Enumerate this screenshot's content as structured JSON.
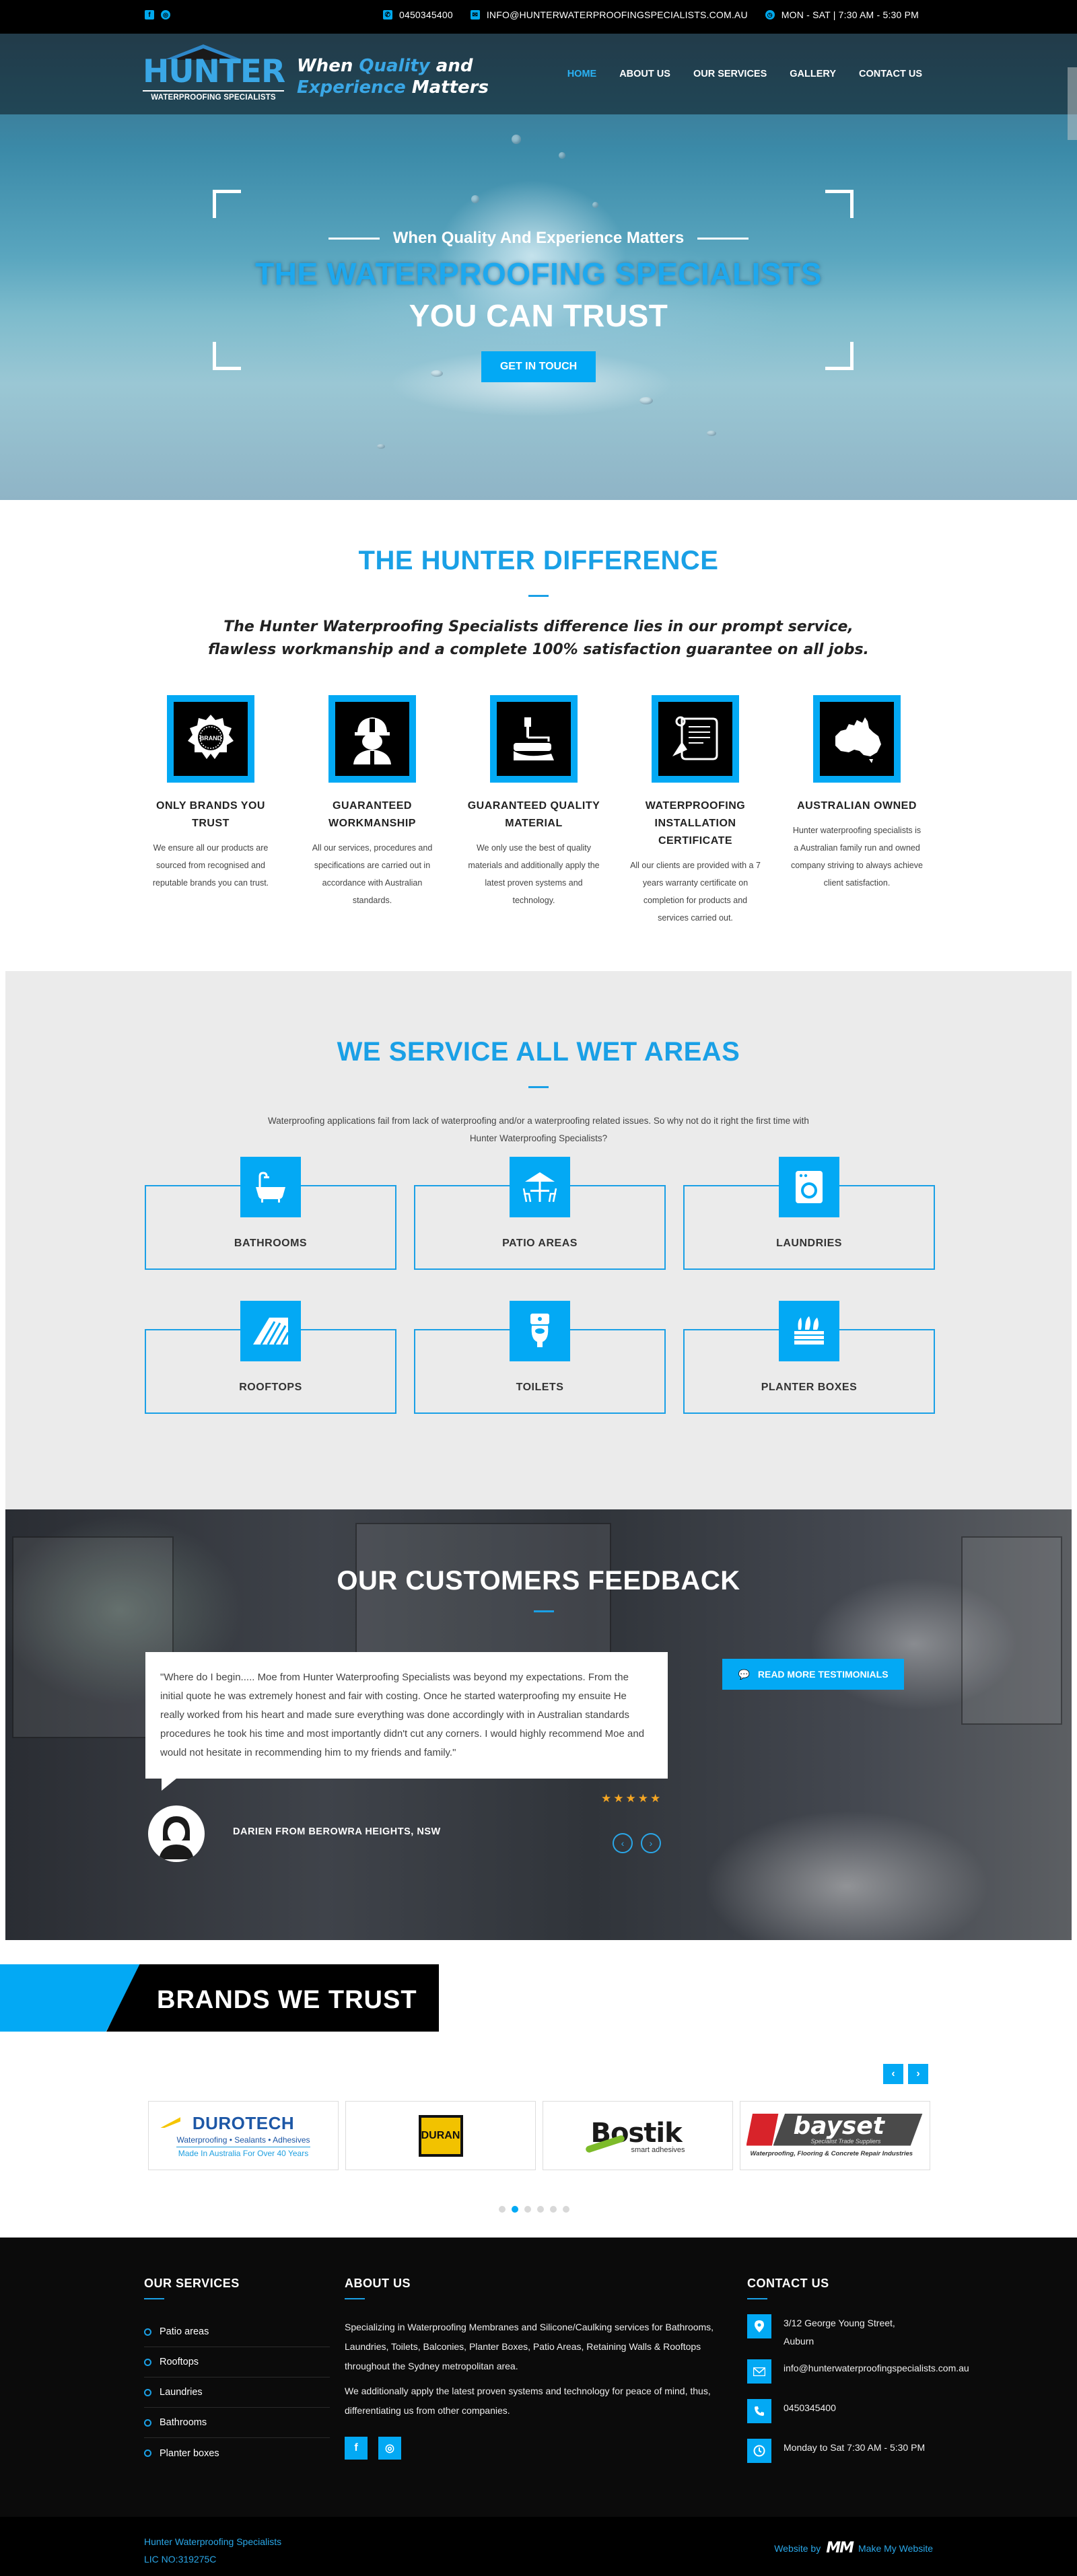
{
  "topbar": {
    "phone": "0450345400",
    "email": "INFO@HUNTERWATERPROOFINGSPECIALISTS.COM.AU",
    "hours": "MON - SAT | 7:30 AM - 5:30 PM"
  },
  "brand": {
    "logo_name": "HUNTER",
    "logo_sub": "WATERPROOFING SPECIALISTS",
    "tagline": [
      "When ",
      "Quality",
      " and",
      "Experience",
      " Matters"
    ]
  },
  "nav": [
    "HOME",
    "ABOUT US",
    "OUR SERVICES",
    "GALLERY",
    "CONTACT US"
  ],
  "hero": {
    "pre": "When Quality And Experience Matters",
    "line1": "THE WATERPROOFING SPECIALISTS",
    "line2": "YOU CAN TRUST",
    "cta": "GET IN TOUCH"
  },
  "difference": {
    "title": "THE HUNTER DIFFERENCE",
    "intro1": "The Hunter Waterproofing Specialists difference lies in our prompt service,",
    "intro2": "flawless workmanship and a complete 100% satisfaction guarantee on all jobs.",
    "features": [
      {
        "icon": "brand-badge-icon",
        "title1": "ONLY BRANDS YOU",
        "title2": "TRUST",
        "text": "We ensure all our products are sourced from recognised and reputable brands you can trust.",
        "badge": "BRAND"
      },
      {
        "icon": "worker-icon",
        "title1": "GUARANTEED",
        "title2": "WORKMANSHIP",
        "text": "All our services, procedures and specifications are carried out in accordance with Australian standards."
      },
      {
        "icon": "paint-roller-icon",
        "title1": "GUARANTEED QUALITY",
        "title2": "MATERIAL",
        "text": "We only use the best of quality materials and additionally apply the latest proven systems and technology."
      },
      {
        "icon": "certificate-icon",
        "title1": "WATERPROOFING",
        "title2": "INSTALLATION",
        "title3": "CERTIFICATE",
        "text": "All our clients are provided with a 7 years warranty certificate on completion for products and services carried out."
      },
      {
        "icon": "australia-map-icon",
        "title1": "AUSTRALIAN OWNED",
        "title2": "",
        "text": "Hunter waterproofing specialists is a Australian family run and owned company striving to always achieve client satisfaction."
      }
    ]
  },
  "wet": {
    "title": "WE SERVICE ALL WET AREAS",
    "intro": "Waterproofing applications fail from lack of waterproofing and/or a waterproofing related issues. So why not do it right the first time with Hunter Waterproofing Specialists?",
    "areas": [
      {
        "label": "BATHROOMS",
        "icon": "bathtub-icon"
      },
      {
        "label": "PATIO AREAS",
        "icon": "patio-table-icon"
      },
      {
        "label": "LAUNDRIES",
        "icon": "washing-machine-icon"
      },
      {
        "label": "ROOFTOPS",
        "icon": "roof-tiles-icon"
      },
      {
        "label": "TOILETS",
        "icon": "toilet-icon"
      },
      {
        "label": "PLANTER BOXES",
        "icon": "planter-box-icon"
      }
    ]
  },
  "feedback": {
    "title": "OUR CUSTOMERS FEEDBACK",
    "quote": "\"Where do I begin..... Moe from Hunter Waterproofing Specialists was beyond my expectations. From the initial quote he was extremely honest and fair with costing. Once he started waterproofing my ensuite He really worked from his heart and made sure everything was done accordingly with in Australian standards procedures he took his time and most importantly didn't cut any corners. I would highly recommend Moe and would not hesitate in recommending him to my friends and family.\"",
    "reviewer": "DARIEN FROM BEROWRA HEIGHTS, NSW",
    "rating": 5,
    "cta": "READ MORE TESTIMONIALS"
  },
  "brands": {
    "title": "BRANDS WE TRUST",
    "items": [
      {
        "name": "DUROTECH",
        "tagline": "Waterproofing • Sealants • Adhesives",
        "note": "Made In Australia For Over 40 Years"
      },
      {
        "name": "DURAN"
      },
      {
        "name": "Bostik",
        "tagline": "smart adhesives"
      },
      {
        "name": "bayset",
        "sub": "Specialist Trade Suppliers",
        "tagline": "Waterproofing, Flooring & Concrete Repair Industries"
      }
    ],
    "dots": 6,
    "active_dot": 1
  },
  "footer": {
    "services_title": "OUR SERVICES",
    "services": [
      "Patio areas",
      "Rooftops",
      "Laundries",
      "Bathrooms",
      "Planter boxes"
    ],
    "about_title": "ABOUT US",
    "about_p1": "Specializing in Waterproofing Membranes and Silicone/Caulking services for Bathrooms, Laundries, Toilets, Balconies, Planter Boxes, Patio Areas, Retaining Walls & Rooftops throughout the Sydney metropolitan area.",
    "about_p2": "We additionally apply the latest proven systems and technology for peace of mind, thus, differentiating us from other companies.",
    "contact_title": "CONTACT US",
    "address1": "3/12 George Young Street,",
    "address2": "Auburn",
    "email": "info@hunterwaterproofingspecialists.com.au",
    "phone": "0450345400",
    "hours": "Monday to Sat 7:30 AM - 5:30 PM"
  },
  "bottom": {
    "company": "Hunter Waterproofing Specialists",
    "lic": "LIC NO:319275C",
    "credit_pre": "Website by",
    "credit_logo": "MM",
    "credit_name": "Make My Website"
  },
  "colors": {
    "accent": "#03a9f4",
    "dark": "#000000",
    "light_bg": "#ebebeb"
  }
}
